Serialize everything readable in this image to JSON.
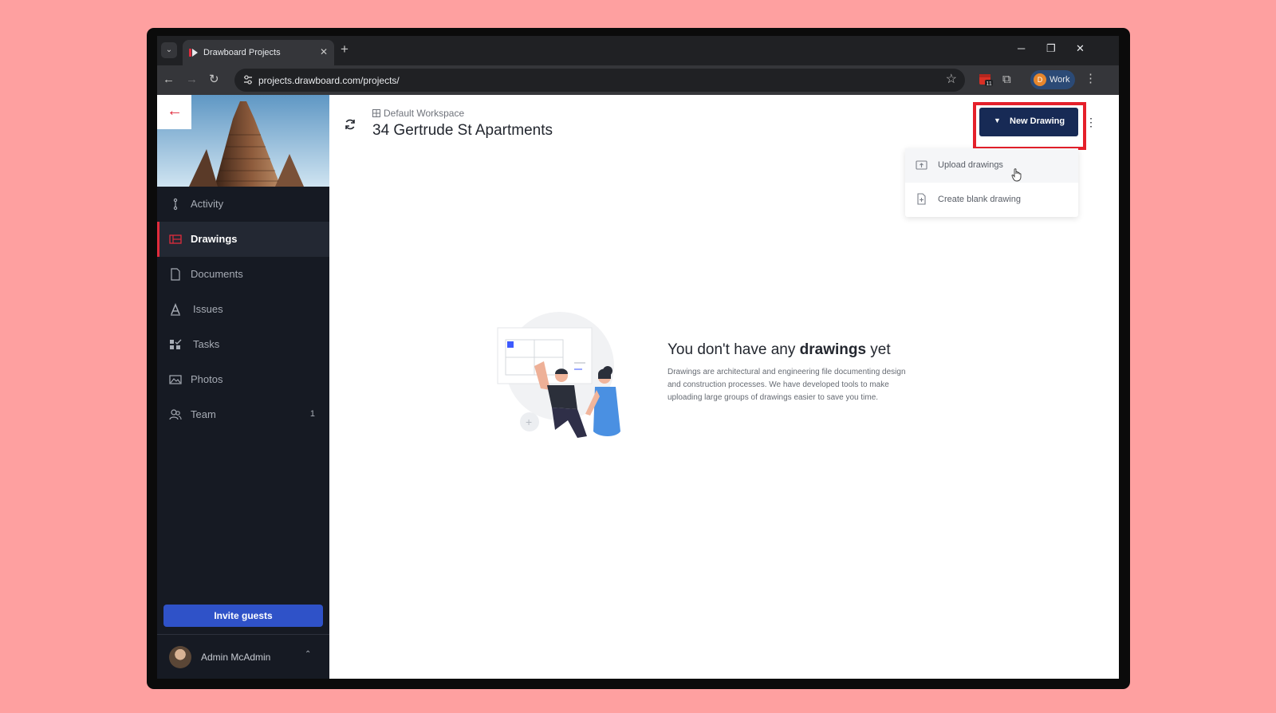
{
  "browser": {
    "tab_title": "Drawboard Projects",
    "tab_close": "✕",
    "new_tab": "+",
    "url": "projects.drawboard.com/projects/",
    "profile_initial": "D",
    "profile_label": "Work",
    "extension_badge": "11"
  },
  "sidebar": {
    "items": [
      {
        "label": "Activity",
        "icon": "activity-icon"
      },
      {
        "label": "Drawings",
        "icon": "drawings-icon",
        "active": true
      },
      {
        "label": "Documents",
        "icon": "document-icon"
      },
      {
        "label": "Issues",
        "icon": "issues-icon"
      },
      {
        "label": "Tasks",
        "icon": "tasks-icon"
      },
      {
        "label": "Photos",
        "icon": "photos-icon"
      },
      {
        "label": "Team",
        "icon": "team-icon",
        "count": "1"
      }
    ],
    "invite_label": "Invite guests",
    "user_name": "Admin McAdmin"
  },
  "header": {
    "workspace": "Default Workspace",
    "project_title": "34 Gertrude St Apartments",
    "new_drawing_label": "New Drawing"
  },
  "dropdown": {
    "items": [
      {
        "label": "Upload drawings",
        "icon": "upload-icon"
      },
      {
        "label": "Create blank drawing",
        "icon": "blank-file-icon"
      }
    ]
  },
  "empty_state": {
    "title_prefix": "You don't have any ",
    "title_bold": "drawings",
    "title_suffix": " yet",
    "description": "Drawings are architectural and engineering file documenting design and construction processes. We have developed tools to make uploading large groups of drawings easier to save you time."
  },
  "colors": {
    "brand_red": "#e02b3c",
    "primary_navy": "#172a55",
    "invite_blue": "#2f52c8",
    "sidebar_bg": "#161a23",
    "highlight_red": "#e5202a"
  }
}
